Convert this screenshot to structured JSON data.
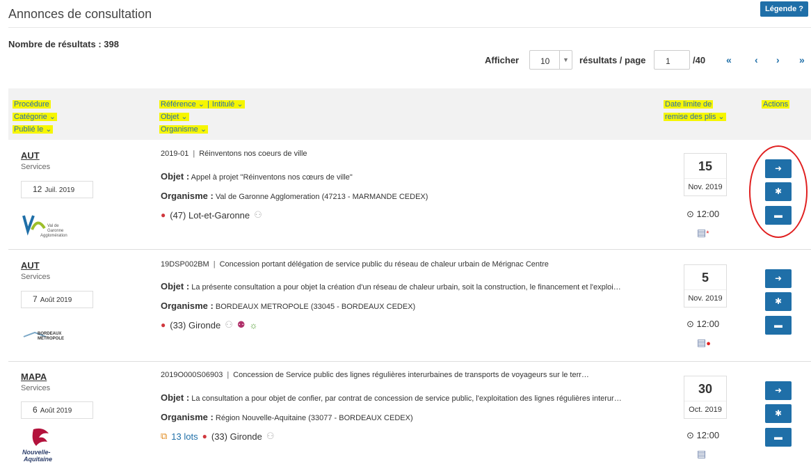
{
  "header": {
    "title": "Annonces de consultation",
    "legend_label": "Légende ?"
  },
  "results": {
    "count_label": "Nombre de résultats : 398"
  },
  "pager": {
    "show_label": "Afficher",
    "per_page_value": "10",
    "per_page_suffix": "résultats / page",
    "current_page": "1",
    "total_pages": "/40",
    "first": "«",
    "prev": "‹",
    "next": "›",
    "last": "»"
  },
  "columns": {
    "procedure": "Procédure",
    "categorie": "Catégorie ⌄",
    "publie": "Publié le ⌄",
    "reference": "Référence ⌄",
    "sep": "|",
    "intitule": "Intitulé ⌄",
    "objet": "Objet ⌄",
    "organisme": "Organisme ⌄",
    "date_limite_1": "Date limite de",
    "date_limite_2": "remise des plis ⌄",
    "actions": "Actions"
  },
  "rows": [
    {
      "procedure": "AUT",
      "categorie": "Services",
      "pub_day": "12",
      "pub_month": "Juil. 2019",
      "reference": "2019-01",
      "intitule": "Réinventons nos coeurs de ville",
      "objet_label": "Objet :",
      "objet": " Appel à projet \"Réinventons nos cœurs de ville\"",
      "org_label": "Organisme :",
      "organisme": " Val de Garonne Agglomeration (47213 - MARMANDE CEDEX)",
      "location": "(47) Lot-et-Garonne",
      "lots": "",
      "deadline_day": "15",
      "deadline_month": "Nov.  2019",
      "deadline_time": "12:00",
      "logo_text": "Val de Garonne Agglomération"
    },
    {
      "procedure": "AUT",
      "categorie": "Services",
      "pub_day": "7",
      "pub_month": "Août 2019",
      "reference": "19DSP002BM",
      "intitule": "Concession portant délégation de service public du réseau de chaleur urbain de Mérignac Centre",
      "objet_label": "Objet :",
      "objet": " La présente consultation a pour objet la création d'un réseau de chaleur urbain, soit la construction, le financement et l'exploi…",
      "org_label": "Organisme :",
      "organisme": " BORDEAUX METROPOLE (33045 - BORDEAUX CEDEX)",
      "location": "(33) Gironde",
      "lots": "",
      "deadline_day": "5",
      "deadline_month": "Nov.  2019",
      "deadline_time": "12:00",
      "logo_text": "BORDEAUX MÉTROPOLE"
    },
    {
      "procedure": "MAPA",
      "categorie": "Services",
      "pub_day": "6",
      "pub_month": "Août 2019",
      "reference": "2019O000S06903",
      "intitule": "Concession de Service public des lignes régulières interurbaines de transports de voyageurs sur le terr…",
      "objet_label": "Objet :",
      "objet": " La consultation a pour objet de confier, par contrat de concession de service public, l'exploitation des lignes régulières interur…",
      "org_label": "Organisme :",
      "organisme": " Région Nouvelle-Aquitaine (33077 - BORDEAUX CEDEX)",
      "location": "(33) Gironde",
      "lots": "13 lots",
      "deadline_day": "30",
      "deadline_month": "Oct.  2019",
      "deadline_time": "12:00",
      "logo_text": "Nouvelle-Aquitaine"
    }
  ],
  "colors": {
    "accent": "#1f6fa8",
    "highlight": "#f6f600",
    "annotation": "#e02020"
  }
}
